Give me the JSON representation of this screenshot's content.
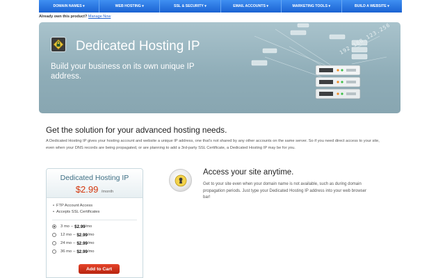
{
  "nav": {
    "items": [
      {
        "label": "DOMAIN NAMES ▾"
      },
      {
        "label": "WEB HOSTING ▾"
      },
      {
        "label": "SSL & SECURITY ▾"
      },
      {
        "label": "EMAIL ACCOUNTS ▾"
      },
      {
        "label": "MARKETING TOOLS ▾"
      },
      {
        "label": "BUILD A WEBSITE ▾"
      }
    ]
  },
  "own": {
    "text": "Already own this product?",
    "link": "Manage Now"
  },
  "hero": {
    "title": "Dedicated Hosting IP",
    "subtitle": "Build your business on its own unique IP address.",
    "ip_text": "192.168.123.256",
    "logo_icon": "lock-badge-icon",
    "art": "server-stack-illustration"
  },
  "main": {
    "headline": "Get the solution for your advanced hosting needs.",
    "intro": "A Dedicated Hosting IP gives your hosting account and website a unique IP address, one that's not shared by any other accounts on the same server. So if you need direct access to your site, even when your DNS records are being propagated, or are planning to add a 3rd-party SSL Certificate, a Dedicated Hosting IP may be for you."
  },
  "plan": {
    "title": "Dedicated Hosting IP",
    "price": "$2.99",
    "price_unit": "/month",
    "features": [
      "FTP Account Access",
      "Accepts SSL Certificates"
    ],
    "terms": [
      {
        "term": "3 mo",
        "dash": "–",
        "price": "$2.99",
        "unit": "/mo",
        "selected": true
      },
      {
        "term": "12 mo",
        "dash": "–",
        "price": "$2.99",
        "unit": "/mo",
        "selected": false
      },
      {
        "term": "24 mo",
        "dash": "–",
        "price": "$2.99",
        "unit": "/mo",
        "selected": false
      },
      {
        "term": "36 mo",
        "dash": "–",
        "price": "$2.99",
        "unit": "/mo",
        "selected": false
      }
    ],
    "cart_label": "Add to Cart"
  },
  "feature": {
    "icon": "keyhole-icon",
    "title": "Access your site anytime.",
    "text": "Get to your site even when your domain name is not available, such as during domain propagation periods. Just type your Dedicated Hosting IP address into your web browser bar!"
  },
  "colors": {
    "nav": "#1b63d2",
    "hero_bg": "#8eacb7",
    "price": "#d4360d",
    "cart_button": "#c72e16"
  }
}
